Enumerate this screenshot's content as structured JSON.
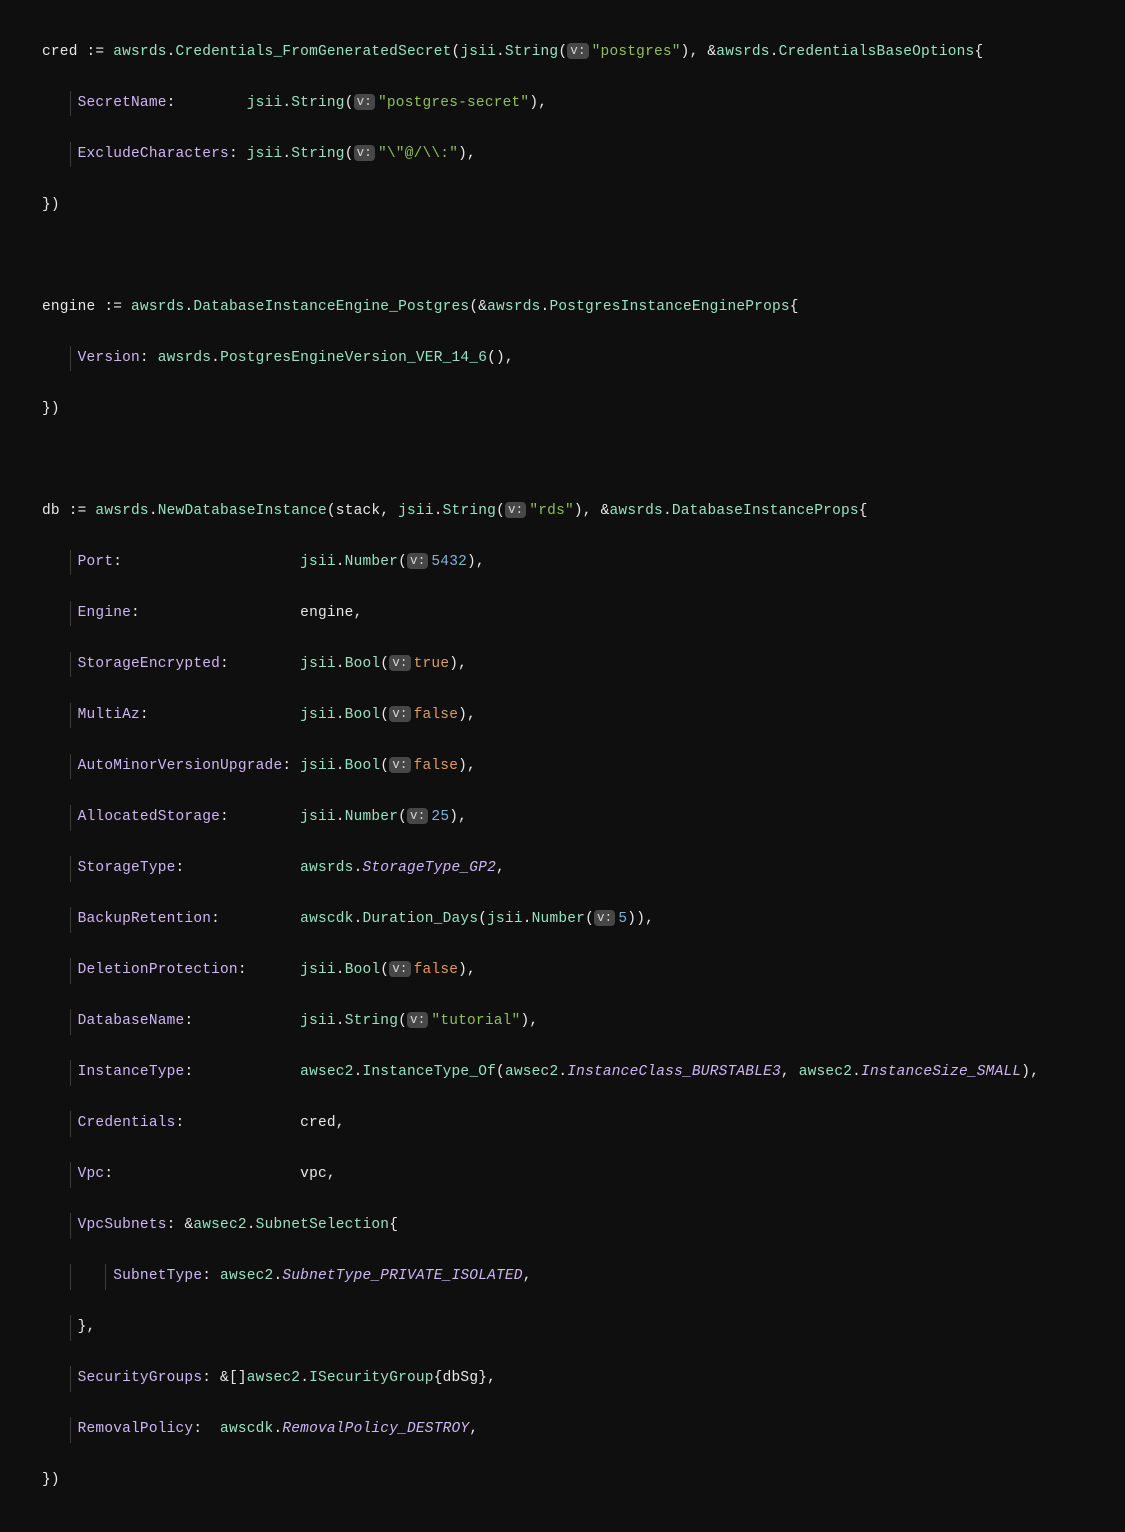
{
  "hint": "v:",
  "t": {
    "cred": "cred",
    "engine": "engine",
    "db": "db",
    "assign": " := ",
    "awsrds": "awsrds",
    "awscdk": "awscdk",
    "awsec2": "awsec2",
    "jsii": "jsii",
    "dot": ".",
    "comma": ",",
    "lparen": "(",
    "rparen": ")",
    "lbrace": "{",
    "rbrace": "}",
    "amp": "&",
    "colon": ":",
    "stack": "stack",
    "vpc": "vpc",
    "credRef": "cred",
    "engineRef": "engine",
    "sliceOpen": "&[]",
    "dbSg": "dbSg",
    "close": "})"
  },
  "fn": {
    "Credentials_FromGeneratedSecret": "Credentials_FromGeneratedSecret",
    "CredentialsBaseOptions": "CredentialsBaseOptions",
    "DatabaseInstanceEngine_Postgres": "DatabaseInstanceEngine_Postgres",
    "PostgresInstanceEngineProps": "PostgresInstanceEngineProps",
    "PostgresEngineVersion_VER_14_6": "PostgresEngineVersion_VER_14_6",
    "NewDatabaseInstance": "NewDatabaseInstance",
    "DatabaseInstanceProps": "DatabaseInstanceProps",
    "String": "String",
    "Number": "Number",
    "Bool": "Bool",
    "Duration_Days": "Duration_Days",
    "InstanceType_Of": "InstanceType_Of",
    "SubnetSelection": "SubnetSelection",
    "ISecurityGroup": "ISecurityGroup"
  },
  "type": {
    "StorageType_GP2": "StorageType_GP2",
    "InstanceClass_BURSTABLE3": "InstanceClass_BURSTABLE3",
    "InstanceSize_SMALL": "InstanceSize_SMALL",
    "SubnetType_PRIVATE_ISOLATED": "SubnetType_PRIVATE_ISOLATED",
    "RemovalPolicy_DESTROY": "RemovalPolicy_DESTROY"
  },
  "str": {
    "postgres": "\"postgres\"",
    "postgresSecret": "\"postgres-secret\"",
    "exclude": "\"\\\"@/\\\\:\"",
    "rds": "\"rds\"",
    "tutorial": "\"tutorial\""
  },
  "num": {
    "port": "5432",
    "alloc": "25",
    "days": "5"
  },
  "bool": {
    "true": "true",
    "false": "false"
  },
  "fld": {
    "SecretName": "SecretName",
    "ExcludeCharacters": "ExcludeCharacters",
    "Version": "Version",
    "Port": "Port",
    "Engine": "Engine",
    "StorageEncrypted": "StorageEncrypted",
    "MultiAz": "MultiAz",
    "AutoMinorVersionUpgrade": "AutoMinorVersionUpgrade",
    "AllocatedStorage": "AllocatedStorage",
    "StorageType": "StorageType",
    "BackupRetention": "BackupRetention",
    "DeletionProtection": "DeletionProtection",
    "DatabaseName": "DatabaseName",
    "InstanceType": "InstanceType",
    "Credentials": "Credentials",
    "Vpc": "Vpc",
    "VpcSubnets": "VpcSubnets",
    "SubnetType": "SubnetType",
    "SecurityGroups": "SecurityGroups",
    "RemovalPolicy": "RemovalPolicy"
  }
}
